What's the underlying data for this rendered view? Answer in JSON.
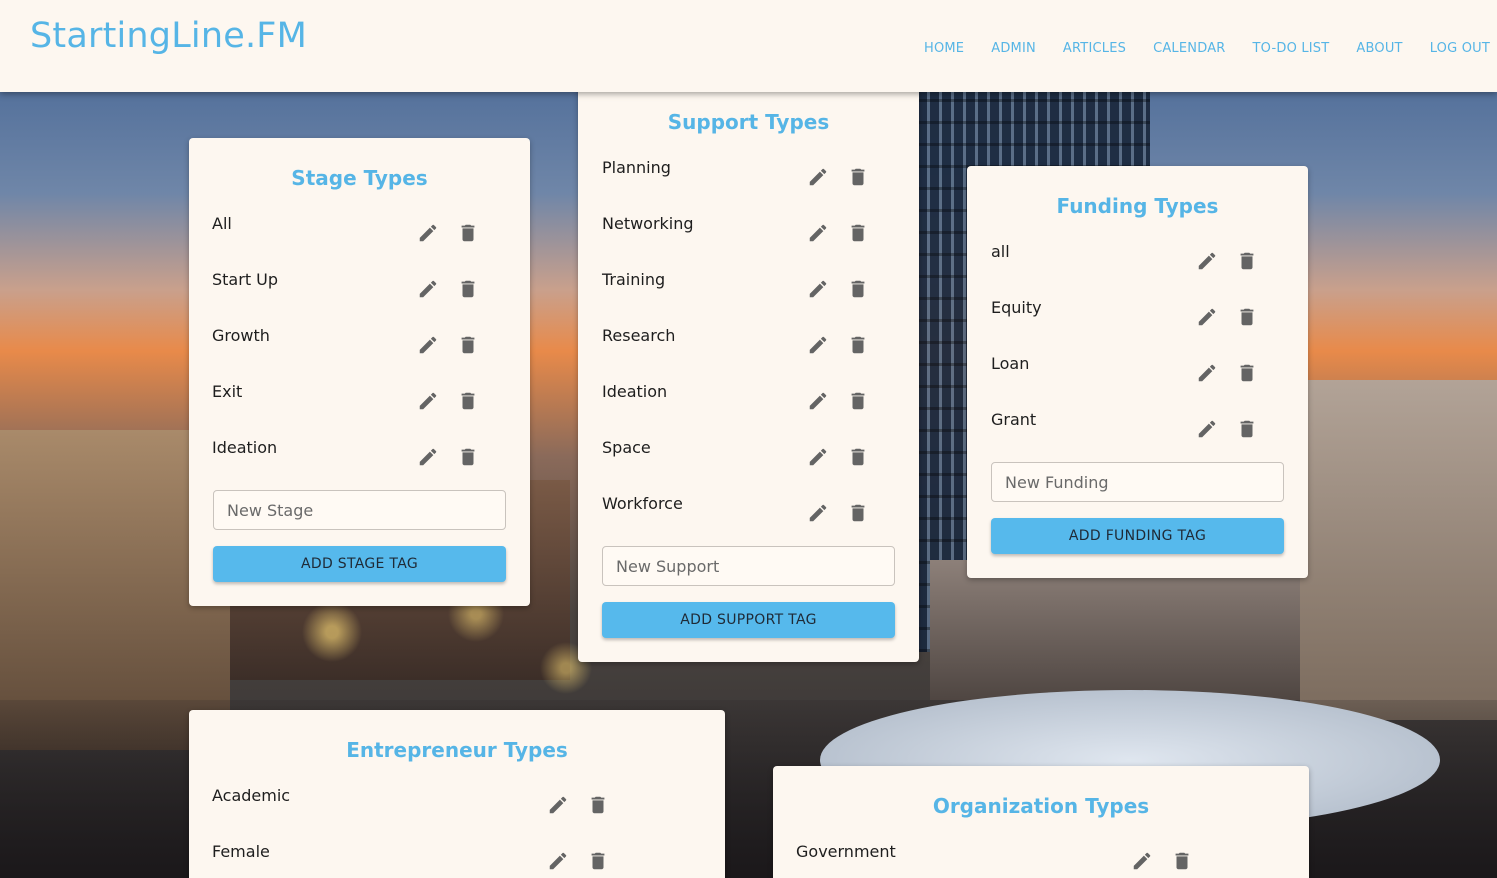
{
  "nav": {
    "brand": "StartingLine.FM",
    "links": [
      "HOME",
      "ADMIN",
      "ARTICLES",
      "CALENDAR",
      "TO-DO LIST",
      "ABOUT",
      "LOG OUT"
    ]
  },
  "stage": {
    "title": "Stage Types",
    "items": [
      "All",
      "Start Up",
      "Growth",
      "Exit",
      "Ideation"
    ],
    "placeholder": "New Stage",
    "button": "ADD STAGE TAG"
  },
  "support": {
    "title": "Support Types",
    "items": [
      "Planning",
      "Networking",
      "Training",
      "Research",
      "Ideation",
      "Space",
      "Workforce"
    ],
    "placeholder": "New Support",
    "button": "ADD SUPPORT TAG"
  },
  "funding": {
    "title": "Funding Types",
    "items": [
      "all",
      "Equity",
      "Loan",
      "Grant"
    ],
    "placeholder": "New Funding",
    "button": "ADD FUNDING TAG"
  },
  "entrepreneur": {
    "title": "Entrepreneur Types",
    "items": [
      "Academic",
      "Female"
    ]
  },
  "organization": {
    "title": "Organization Types",
    "items": [
      "Government"
    ]
  },
  "icons": {
    "edit": "pencil-icon",
    "delete": "trash-icon"
  },
  "colors": {
    "accent": "#56b5e6",
    "button": "#56b9ec",
    "card": "#fdf7f0",
    "icon": "#646464"
  }
}
